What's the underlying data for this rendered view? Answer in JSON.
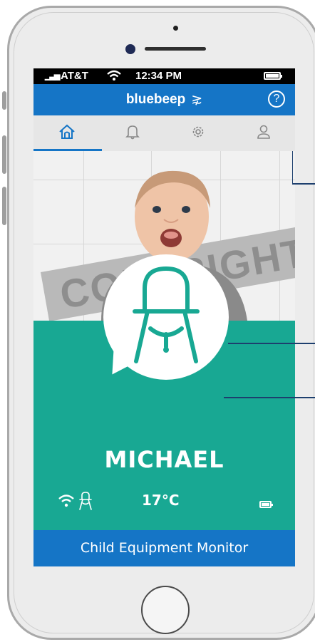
{
  "status_bar": {
    "signal": "▁▃▅",
    "carrier": "AT&T",
    "wifi": "⌔",
    "time": "12:34 PM"
  },
  "app_bar": {
    "title": "bluebeep",
    "logo_mark": "⋧",
    "help": "?"
  },
  "tabs": [
    {
      "name": "home",
      "icon": "home-icon",
      "active": true
    },
    {
      "name": "notifications",
      "icon": "bell-icon",
      "active": false
    },
    {
      "name": "settings",
      "icon": "gear-icon",
      "active": false
    },
    {
      "name": "profile",
      "icon": "user-icon",
      "active": false
    }
  ],
  "photo": {
    "watermark": "COPYRIGHT"
  },
  "device": {
    "name": "MICHAEL",
    "temperature": "17°C",
    "icon": "high-chair-icon"
  },
  "footer": {
    "label": "Child Equipment Monitor"
  },
  "colors": {
    "brand_blue": "#1575c6",
    "teal": "#18a893",
    "callout": "#1d3f6e"
  }
}
